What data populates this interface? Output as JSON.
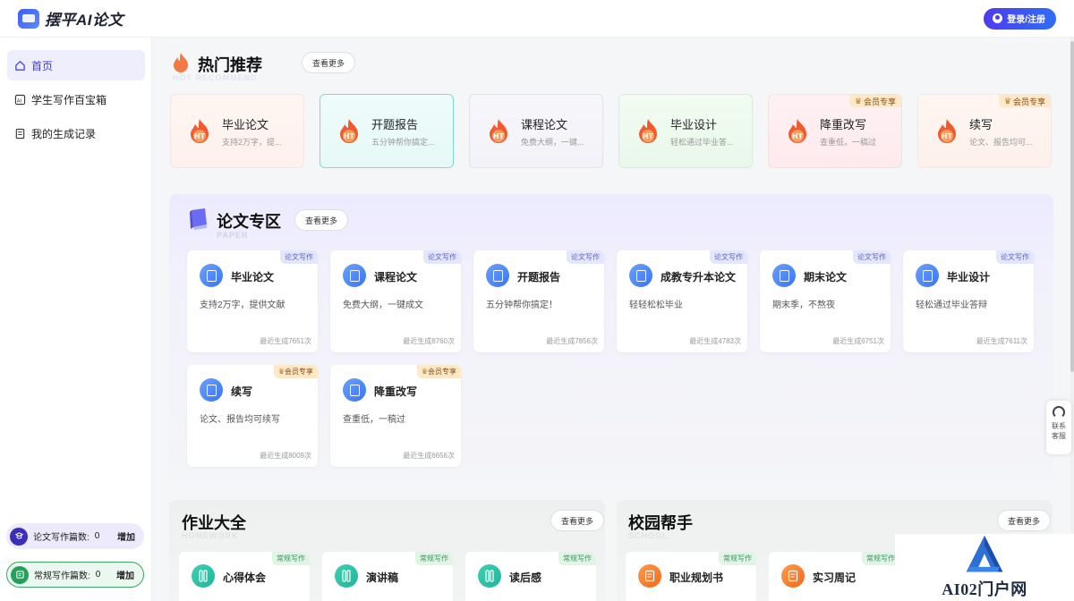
{
  "header": {
    "logo_text": "摆平AI论文",
    "login_label": "登录/注册"
  },
  "sidebar": {
    "items": [
      {
        "label": "首页",
        "icon": "home-icon",
        "active": true
      },
      {
        "label": "学生写作百宝箱",
        "icon": "ai-box-icon",
        "active": false
      },
      {
        "label": "我的生成记录",
        "icon": "record-icon",
        "active": false
      }
    ],
    "stats": [
      {
        "label": "论文写作篇数:",
        "count": "0",
        "action": "增加",
        "icon": "paper-stat-icon"
      },
      {
        "label": "常规写作篇数:",
        "count": "0",
        "action": "增加",
        "icon": "edit-stat-icon"
      }
    ]
  },
  "hot": {
    "title": "热门推荐",
    "subtitle": "HOT RECOMMEND",
    "more": "查看更多",
    "cards": [
      {
        "title": "毕业论文",
        "desc": "支持2万字，提...",
        "vip": ""
      },
      {
        "title": "开题报告",
        "desc": "五分钟帮你搞定...",
        "vip": ""
      },
      {
        "title": "课程论文",
        "desc": "免费大纲，一键...",
        "vip": ""
      },
      {
        "title": "毕业设计",
        "desc": "轻松通过毕业答...",
        "vip": ""
      },
      {
        "title": "降重改写",
        "desc": "查重低，一稿过",
        "vip": "会员专享"
      },
      {
        "title": "续写",
        "desc": "论文、报告均可...",
        "vip": "会员专享"
      }
    ],
    "flame_text": "HT"
  },
  "paper": {
    "title": "论文专区",
    "subtitle": "PAPER",
    "more": "查看更多",
    "cards": [
      {
        "title": "毕业论文",
        "desc": "支持2万字，提供文献",
        "count": "最近生成7651次",
        "tag": "论文写作"
      },
      {
        "title": "课程论文",
        "desc": "免费大纲，一键成文",
        "count": "最近生成8760次",
        "tag": "论文写作"
      },
      {
        "title": "开题报告",
        "desc": "五分钟帮你搞定！",
        "count": "最近生成7856次",
        "tag": "论文写作"
      },
      {
        "title": "成教专升本论文",
        "desc": "轻轻松松毕业",
        "count": "最近生成4783次",
        "tag": "论文写作"
      },
      {
        "title": "期末论文",
        "desc": "期末季，不熬夜",
        "count": "最近生成6751次",
        "tag": "论文写作"
      },
      {
        "title": "毕业设计",
        "desc": "轻松通过毕业答辩",
        "count": "最近生成7611次",
        "tag": "论文写作"
      },
      {
        "title": "续写",
        "desc": "论文、报告均可续写",
        "count": "最近生成8009次",
        "tag": "会员专享"
      },
      {
        "title": "降重改写",
        "desc": "查重低，一稿过",
        "count": "最近生成6656次",
        "tag": "会员专享"
      }
    ]
  },
  "homework": {
    "title": "作业大全",
    "subtitle": "HOMEWORK",
    "more": "查看更多",
    "cards": [
      {
        "title": "心得体会",
        "tag": "常规写作"
      },
      {
        "title": "演讲稿",
        "tag": "常规写作"
      },
      {
        "title": "读后感",
        "tag": "常规写作"
      }
    ]
  },
  "campus": {
    "title": "校园帮手",
    "subtitle": "SCHOOL",
    "more": "查看更多",
    "cards": [
      {
        "title": "职业规划书",
        "tag": "常规写作"
      },
      {
        "title": "实习周记",
        "tag": "常规写作"
      }
    ]
  },
  "service": {
    "line1": "联系",
    "line2": "客服"
  },
  "watermark": {
    "text": "AI02门户网"
  },
  "colors": {
    "accent": "#3c3ce0",
    "vip_bg": "#fde8c8",
    "tag_bg": "#e4e6fb",
    "green_tag": "#e0f5e6"
  }
}
